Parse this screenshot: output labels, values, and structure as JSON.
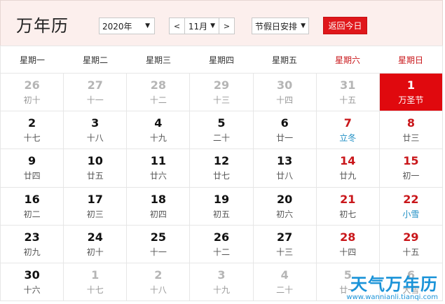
{
  "header": {
    "title": "万年历",
    "year_select": "2020年",
    "month_prev": "<",
    "month_value": "11月",
    "month_next": ">",
    "holiday_select": "节假日安排",
    "today_button": "返回今日"
  },
  "weekdays": [
    "星期一",
    "星期二",
    "星期三",
    "星期四",
    "星期五",
    "星期六",
    "星期日"
  ],
  "weeks": [
    [
      {
        "day": "26",
        "lunar": "初十",
        "other": true
      },
      {
        "day": "27",
        "lunar": "十一",
        "other": true
      },
      {
        "day": "28",
        "lunar": "十二",
        "other": true
      },
      {
        "day": "29",
        "lunar": "十三",
        "other": true
      },
      {
        "day": "30",
        "lunar": "十四",
        "other": true
      },
      {
        "day": "31",
        "lunar": "十五",
        "other": true
      },
      {
        "day": "1",
        "lunar": "万圣节",
        "today": true
      }
    ],
    [
      {
        "day": "2",
        "lunar": "十七"
      },
      {
        "day": "3",
        "lunar": "十八"
      },
      {
        "day": "4",
        "lunar": "十九"
      },
      {
        "day": "5",
        "lunar": "二十"
      },
      {
        "day": "6",
        "lunar": "廿一"
      },
      {
        "day": "7",
        "lunar": "立冬",
        "weekend": true,
        "term": true
      },
      {
        "day": "8",
        "lunar": "廿三",
        "weekend": true
      }
    ],
    [
      {
        "day": "9",
        "lunar": "廿四"
      },
      {
        "day": "10",
        "lunar": "廿五"
      },
      {
        "day": "11",
        "lunar": "廿六"
      },
      {
        "day": "12",
        "lunar": "廿七"
      },
      {
        "day": "13",
        "lunar": "廿八"
      },
      {
        "day": "14",
        "lunar": "廿九",
        "weekend": true
      },
      {
        "day": "15",
        "lunar": "初一",
        "weekend": true
      }
    ],
    [
      {
        "day": "16",
        "lunar": "初二"
      },
      {
        "day": "17",
        "lunar": "初三"
      },
      {
        "day": "18",
        "lunar": "初四"
      },
      {
        "day": "19",
        "lunar": "初五"
      },
      {
        "day": "20",
        "lunar": "初六"
      },
      {
        "day": "21",
        "lunar": "初七",
        "weekend": true
      },
      {
        "day": "22",
        "lunar": "小雪",
        "weekend": true,
        "term": true
      }
    ],
    [
      {
        "day": "23",
        "lunar": "初九"
      },
      {
        "day": "24",
        "lunar": "初十"
      },
      {
        "day": "25",
        "lunar": "十一"
      },
      {
        "day": "26",
        "lunar": "十二"
      },
      {
        "day": "27",
        "lunar": "十三"
      },
      {
        "day": "28",
        "lunar": "十四",
        "weekend": true
      },
      {
        "day": "29",
        "lunar": "十五",
        "weekend": true
      }
    ],
    [
      {
        "day": "30",
        "lunar": "十六"
      },
      {
        "day": "1",
        "lunar": "十七",
        "other": true
      },
      {
        "day": "2",
        "lunar": "十八",
        "other": true
      },
      {
        "day": "3",
        "lunar": "十九",
        "other": true
      },
      {
        "day": "4",
        "lunar": "二十",
        "other": true
      },
      {
        "day": "5",
        "lunar": "廿一",
        "other": true
      },
      {
        "day": "6",
        "lunar": "大雪",
        "other": true
      }
    ]
  ],
  "watermark": {
    "main": "天气万年历",
    "url": "www.wannianli.tianqi.com"
  },
  "colors": {
    "accent_red": "#e0090e",
    "weekend_red": "#c9161a",
    "solar_term_blue": "#1d8ec4",
    "header_bg": "#fcefed"
  }
}
